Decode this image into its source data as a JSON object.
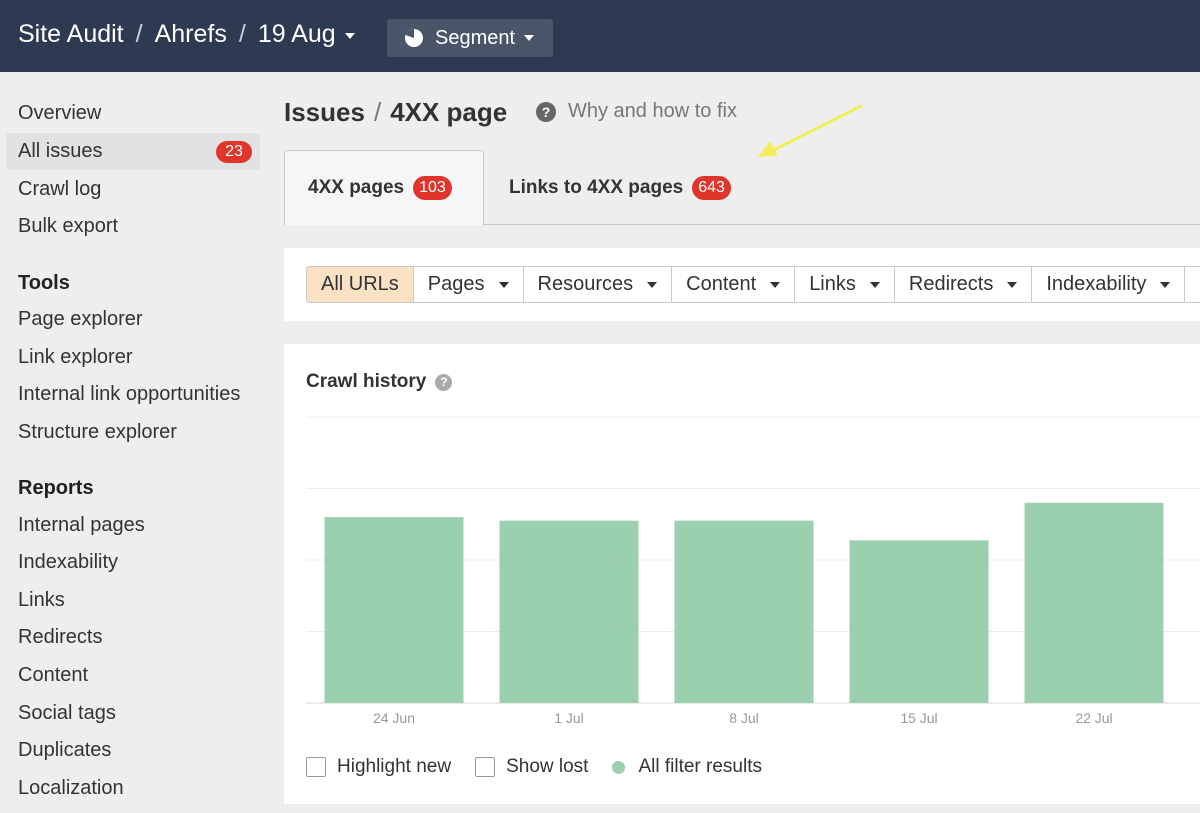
{
  "topbar": {
    "crumbs": [
      "Site Audit",
      "Ahrefs",
      "19 Aug"
    ],
    "segment_label": "Segment"
  },
  "sidebar": {
    "top_items": [
      {
        "label": "Overview"
      },
      {
        "label": "All issues",
        "badge": "23"
      },
      {
        "label": "Crawl log"
      },
      {
        "label": "Bulk export"
      }
    ],
    "tools_heading": "Tools",
    "tools": [
      "Page explorer",
      "Link explorer",
      "Internal link opportunities",
      "Structure explorer"
    ],
    "reports_heading": "Reports",
    "reports": [
      "Internal pages",
      "Indexability",
      "Links",
      "Redirects",
      "Content",
      "Social tags",
      "Duplicates",
      "Localization"
    ]
  },
  "header": {
    "section": "Issues",
    "page": "4XX page",
    "help_text": "Why and how to fix"
  },
  "tabs": [
    {
      "label": "4XX pages",
      "badge": "103"
    },
    {
      "label": "Links to 4XX pages",
      "badge": "643"
    }
  ],
  "filters": [
    {
      "label": "All URLs"
    },
    {
      "label": "Pages"
    },
    {
      "label": "Resources"
    },
    {
      "label": "Content"
    },
    {
      "label": "Links"
    },
    {
      "label": "Redirects"
    },
    {
      "label": "Indexability"
    }
  ],
  "chart_panel": {
    "title": "Crawl history",
    "highlight_new": "Highlight new",
    "show_lost": "Show lost",
    "legend_series": "All filter results"
  },
  "colors": {
    "topbar": "#2e3a52",
    "badge": "#e0352b",
    "bar": "#9ad0ad",
    "active_filter": "#fbe1c3",
    "annotation_arrow": "#f2ee5a"
  },
  "chart_data": {
    "type": "bar",
    "categories": [
      "24 Jun",
      "1 Jul",
      "8 Jul",
      "15 Jul",
      "22 Jul"
    ],
    "values": [
      104,
      102,
      102,
      91,
      112
    ],
    "ylim": [
      0,
      160
    ],
    "grid": true,
    "legend": "bottom-left",
    "xlabel": "",
    "ylabel": ""
  }
}
